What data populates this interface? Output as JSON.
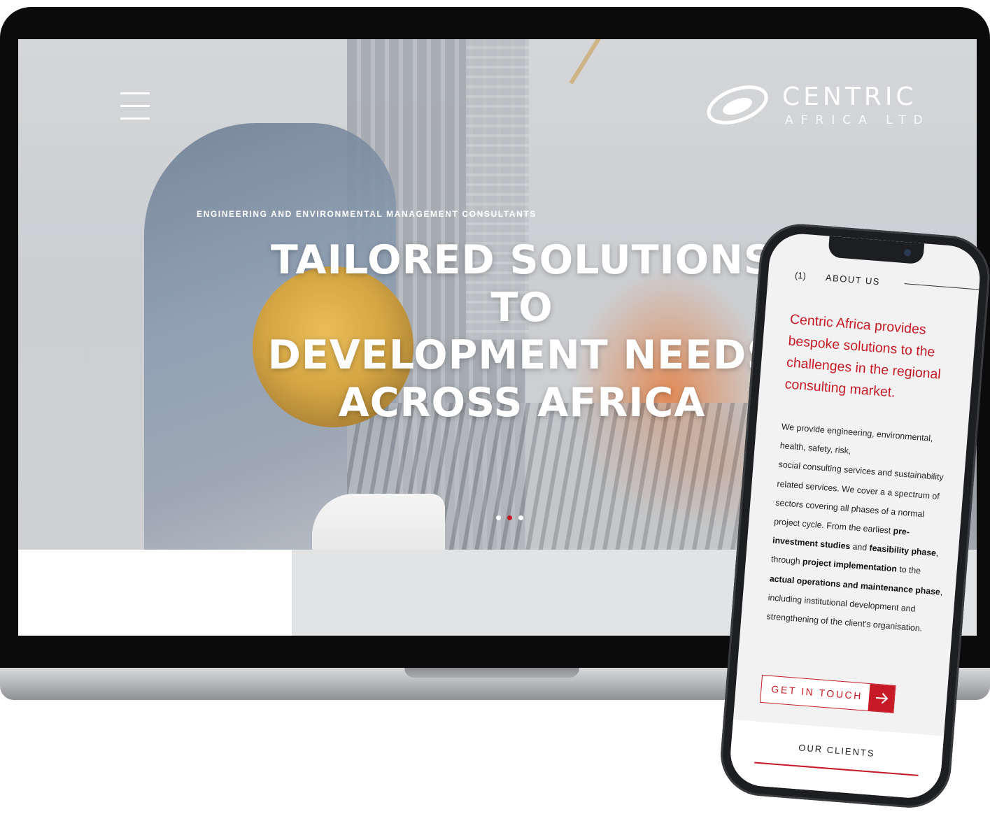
{
  "site": {
    "logo": {
      "name": "CENTRIC",
      "subtitle": "AFRICA LTD"
    },
    "hero": {
      "kicker": "ENGINEERING AND ENVIRONMENTAL MANAGEMENT CONSULTANTS",
      "title_line1": "TAILORED SOLUTIONS TO",
      "title_line2": "DEVELOPMENT NEEDS",
      "title_line3": "ACROSS AFRICA",
      "slides": 3,
      "active_slide": 2
    }
  },
  "mobile": {
    "section_number": "(1)",
    "section_label": "ABOUT US",
    "heading": "Centric Africa provides bespoke solutions to the challenges in the regional consulting market.",
    "body": {
      "p1": "We provide engineering, environmental, health, safety, risk,",
      "p2": "social consulting services and sustainability related services. We cover a a spectrum of sectors covering all phases of a normal project cycle. From the earliest ",
      "b1": "pre-investment studies",
      "t1": " and ",
      "b2": "feasibility phase",
      "t2": ", through ",
      "b3": "project implementation",
      "t3": " to the ",
      "b4": "actual operations and maintenance phase",
      "t4": ", including institutional development and strengthening of the client's organisation."
    },
    "cta_label": "GET IN TOUCH",
    "next_section": "OUR CLIENTS"
  },
  "colors": {
    "accent": "#c61b27",
    "text": "#222222",
    "hero_text": "#ffffff"
  },
  "icons": {
    "menu": "hamburger-icon",
    "cta": "arrow-right-icon",
    "logo": "centric-logo-mark"
  }
}
